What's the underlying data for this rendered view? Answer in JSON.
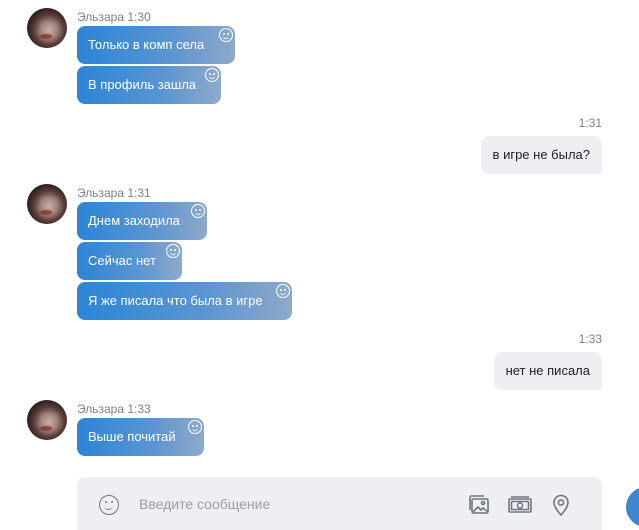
{
  "messages": {
    "group1": {
      "sender": "Эльзара 1:30",
      "bubbles": [
        "Только в комп села",
        "В профиль зашла"
      ]
    },
    "out1": {
      "time": "1:31",
      "text": "в игре не была?"
    },
    "group2": {
      "sender": "Эльзара 1:31",
      "bubbles": [
        "Днем заходила",
        "Сейчас нет",
        "Я же писала что была в игре"
      ]
    },
    "out2": {
      "time": "1:33",
      "text": "нет не писала"
    },
    "group3": {
      "sender": "Эльзара 1:33",
      "bubbles": [
        "Выше почитай"
      ]
    }
  },
  "composer": {
    "placeholder": "Введите сообщение",
    "icons": [
      "emoji-icon",
      "gallery-icon",
      "money-icon",
      "location-icon"
    ]
  },
  "colors": {
    "incoming_gradient_start": "#2b85d6",
    "incoming_gradient_end": "#8fa9c9",
    "outgoing_bg": "#eeeff3",
    "composer_bg": "#eeeff3",
    "accent": "#3f86d1"
  }
}
